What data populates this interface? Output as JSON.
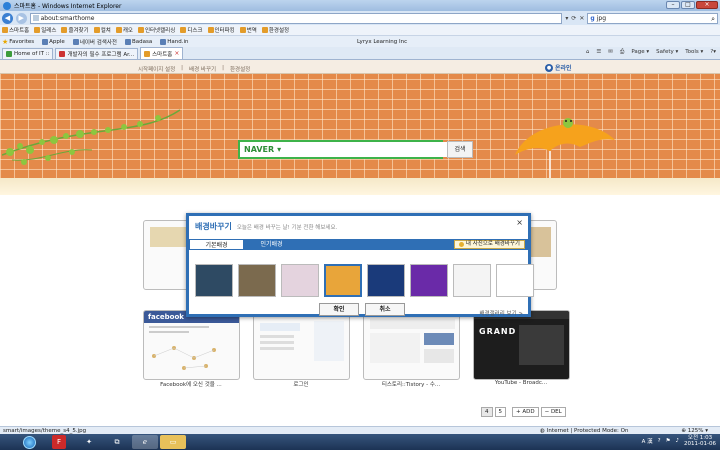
{
  "window": {
    "title": "스마트홈 - Windows Internet Explorer"
  },
  "address": {
    "url": "about:smarthome",
    "search_value": "jpg",
    "search_engine_glyph": "g"
  },
  "links_bar": {
    "items": [
      "스마트홈",
      "일레스",
      "즐겨찾기",
      "컬쳐",
      "캐오",
      "인터넷캘리싱",
      "디스크",
      "인터파킹",
      "번역",
      "환경설정"
    ]
  },
  "favorites_bar": {
    "label": "Favorites",
    "items": [
      "Apple",
      "네이버 검색사전",
      "Badasa",
      "Hand.in"
    ],
    "extra": "Lyryx Learning Inc"
  },
  "tabs": [
    {
      "label": "Home of IT :: ",
      "active": false
    },
    {
      "label": "개발자의 필수 프로그램 Ar...",
      "active": false
    },
    {
      "label": "스마트홈",
      "active": true
    }
  ],
  "ie_commands": [
    "Page ▾",
    "Safety ▾",
    "Tools ▾",
    "?▾"
  ],
  "page": {
    "top_links": [
      "시작페이지 설정",
      "|",
      "배경 바꾸기",
      "|",
      "환경설정"
    ],
    "online_label": "온라인",
    "search": {
      "logo": "NAVER",
      "button": "검색"
    },
    "thumbs": [
      {
        "caption": "Facebook에 오신 것을 ..."
      },
      {
        "caption": "로그인"
      },
      {
        "caption": "티스토리::Tistory - 수..."
      },
      {
        "caption": "YouTube - Broadc..."
      }
    ],
    "fb_logo": "facebook",
    "yt_text": "GRAND",
    "pager": [
      "4",
      "5",
      "+ ADD",
      "− DEL"
    ]
  },
  "dialog": {
    "title": "배경바꾸기",
    "subtitle": "오늘은 배경 바꾸는 날! 기분 전환 해보세요.",
    "close": "×",
    "tabs": [
      "기본배경",
      "인기배경"
    ],
    "photo_button": "내 사진으로 배경바꾸기",
    "ok": "확인",
    "cancel": "취소",
    "gallery_link": "배경갤러리 보기 >",
    "swatch_colors": [
      "#2e4a63",
      "#7b6a4e",
      "#e4d3de",
      "#e8a53a",
      "#1a3a7a",
      "#6a2aa8",
      "#f4f4f4",
      "#ffffff"
    ]
  },
  "status": {
    "left": "smart/images/theme_s4_5.jpg",
    "zone": "Internet | Protected Mode: On",
    "zoom": "125%"
  },
  "taskbar": {
    "lang": "A 漢",
    "time": "오전 1:03",
    "date": "2011-01-06"
  },
  "colors": {
    "accent": "#2f6fb5",
    "naver_green": "#3eb34a",
    "brick": "#e48a4a"
  }
}
